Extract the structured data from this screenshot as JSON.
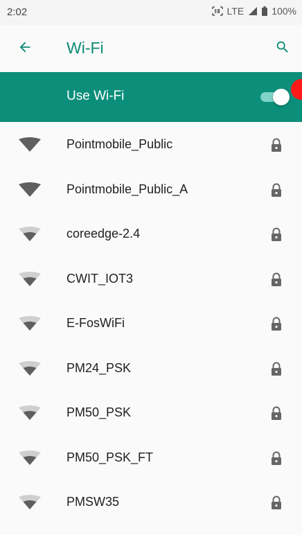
{
  "status_bar": {
    "time": "2:02",
    "network": "LTE",
    "battery": "100%"
  },
  "header": {
    "title": "Wi-Fi",
    "back_icon": "arrow-back-icon",
    "search_icon": "search-icon"
  },
  "master_switch": {
    "label": "Use Wi-Fi",
    "enabled": true
  },
  "colors": {
    "accent": "#0c8a76",
    "bar": "#0c8f7a",
    "toggle_track": "#7fd3c7",
    "touch_dot": "#ff1a1a"
  },
  "networks": [
    {
      "ssid": "Pointmobile_Public",
      "secured": true,
      "signal": "strong"
    },
    {
      "ssid": "Pointmobile_Public_A",
      "secured": true,
      "signal": "strong"
    },
    {
      "ssid": "coreedge-2.4",
      "secured": true,
      "signal": "medium"
    },
    {
      "ssid": "CWIT_IOT3",
      "secured": true,
      "signal": "medium"
    },
    {
      "ssid": "E-FosWiFi",
      "secured": true,
      "signal": "medium"
    },
    {
      "ssid": "PM24_PSK",
      "secured": true,
      "signal": "medium"
    },
    {
      "ssid": "PM50_PSK",
      "secured": true,
      "signal": "medium"
    },
    {
      "ssid": "PM50_PSK_FT",
      "secured": true,
      "signal": "medium"
    },
    {
      "ssid": "PMSW35",
      "secured": true,
      "signal": "medium"
    }
  ]
}
